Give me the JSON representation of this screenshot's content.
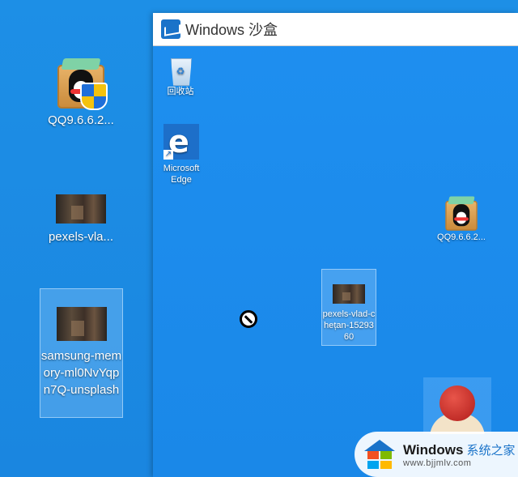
{
  "desktop": {
    "icons": [
      {
        "label": "QQ9.6.6.2..."
      },
      {
        "label": "pexels-vla..."
      },
      {
        "label": "samsung-memory-ml0NvYqpn7Q-unsplash"
      }
    ]
  },
  "sandbox": {
    "title": "Windows 沙盒",
    "icons": [
      {
        "label": "回收站"
      },
      {
        "label": "Microsoft Edge"
      },
      {
        "label": "QQ9.6.6.2..."
      },
      {
        "label": "pexels-vlad-chețan-1529360"
      }
    ]
  },
  "watermark": {
    "brand": "Windows",
    "brand_cn": "系统之家",
    "url": "www.bjjmlv.com"
  },
  "colors": {
    "desktop_bg": "#1d8fe6",
    "accent": "#1a73c9"
  }
}
